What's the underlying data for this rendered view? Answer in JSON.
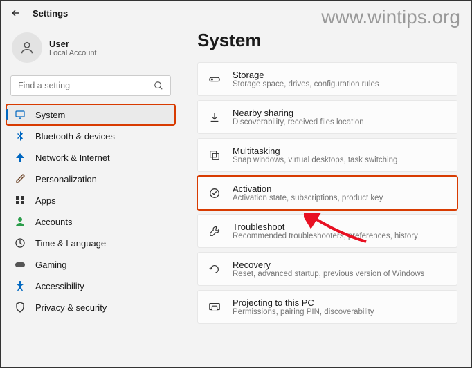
{
  "watermark": "www.wintips.org",
  "header": {
    "title": "Settings"
  },
  "user": {
    "name": "User",
    "sub": "Local Account"
  },
  "search": {
    "placeholder": "Find a setting"
  },
  "nav": [
    {
      "key": "system",
      "label": "System",
      "selected": true,
      "highlighted": true
    },
    {
      "key": "bluetooth",
      "label": "Bluetooth & devices"
    },
    {
      "key": "network",
      "label": "Network & Internet"
    },
    {
      "key": "personalization",
      "label": "Personalization"
    },
    {
      "key": "apps",
      "label": "Apps"
    },
    {
      "key": "accounts",
      "label": "Accounts"
    },
    {
      "key": "time",
      "label": "Time & Language"
    },
    {
      "key": "gaming",
      "label": "Gaming"
    },
    {
      "key": "accessibility",
      "label": "Accessibility"
    },
    {
      "key": "privacy",
      "label": "Privacy & security"
    }
  ],
  "page": {
    "title": "System"
  },
  "cards": [
    {
      "key": "storage",
      "title": "Storage",
      "sub": "Storage space, drives, configuration rules"
    },
    {
      "key": "nearby",
      "title": "Nearby sharing",
      "sub": "Discoverability, received files location"
    },
    {
      "key": "multitasking",
      "title": "Multitasking",
      "sub": "Snap windows, virtual desktops, task switching"
    },
    {
      "key": "activation",
      "title": "Activation",
      "sub": "Activation state, subscriptions, product key",
      "highlighted": true
    },
    {
      "key": "troubleshoot",
      "title": "Troubleshoot",
      "sub": "Recommended troubleshooters, preferences, history"
    },
    {
      "key": "recovery",
      "title": "Recovery",
      "sub": "Reset, advanced startup, previous version of Windows"
    },
    {
      "key": "projecting",
      "title": "Projecting to this PC",
      "sub": "Permissions, pairing PIN, discoverability"
    }
  ]
}
